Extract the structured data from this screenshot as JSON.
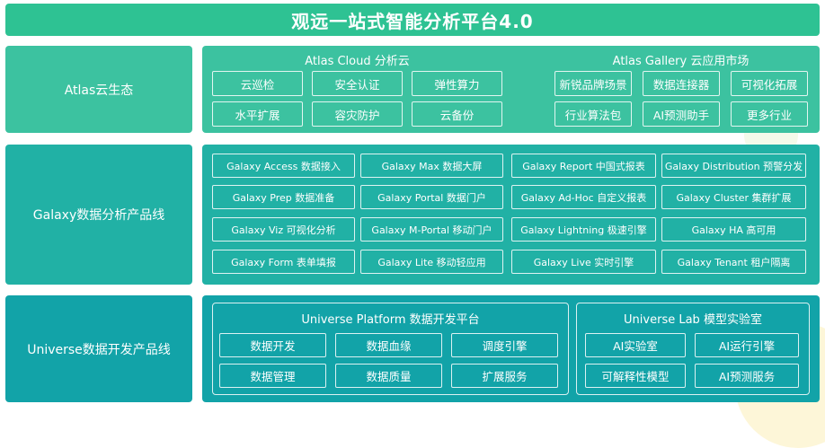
{
  "title": "观远一站式智能分析平台4.0",
  "rows": {
    "atlas": {
      "label": "Atlas云生态",
      "cloud": {
        "title": "Atlas Cloud 分析云",
        "items": [
          "云巡检",
          "安全认证",
          "弹性算力",
          "水平扩展",
          "容灾防护",
          "云备份"
        ]
      },
      "gallery": {
        "title": "Atlas Gallery 云应用市场",
        "items": [
          "新锐品牌场景",
          "数据连接器",
          "可视化拓展",
          "行业算法包",
          "AI预测助手",
          "更多行业"
        ]
      }
    },
    "galaxy": {
      "label": "Galaxy数据分析产品线",
      "items": [
        "Galaxy Access 数据接入",
        "Galaxy Max 数据大屏",
        "Galaxy Report 中国式报表",
        "Galaxy Distribution 预警分发",
        "Galaxy Prep 数据准备",
        "Galaxy Portal 数据门户",
        "Galaxy Ad-Hoc 自定义报表",
        "Galaxy Cluster 集群扩展",
        "Galaxy Viz 可视化分析",
        "Galaxy M-Portal 移动门户",
        "Galaxy Lightning 极速引擎",
        "Galaxy HA 高可用",
        "Galaxy Form 表单填报",
        "Galaxy Lite 移动轻应用",
        "Galaxy Live 实时引擎",
        "Galaxy Tenant 租户隔离"
      ]
    },
    "universe": {
      "label": "Universe数据开发产品线",
      "platform": {
        "title": "Universe Platform 数据开发平台",
        "items": [
          "数据开发",
          "数据血缘",
          "调度引擎",
          "数据管理",
          "数据质量",
          "扩展服务"
        ]
      },
      "lab": {
        "title": "Universe Lab 模型实验室",
        "items": [
          "AI实验室",
          "AI运行引擎",
          "可解释性模型",
          "AI预测服务"
        ]
      }
    }
  }
}
